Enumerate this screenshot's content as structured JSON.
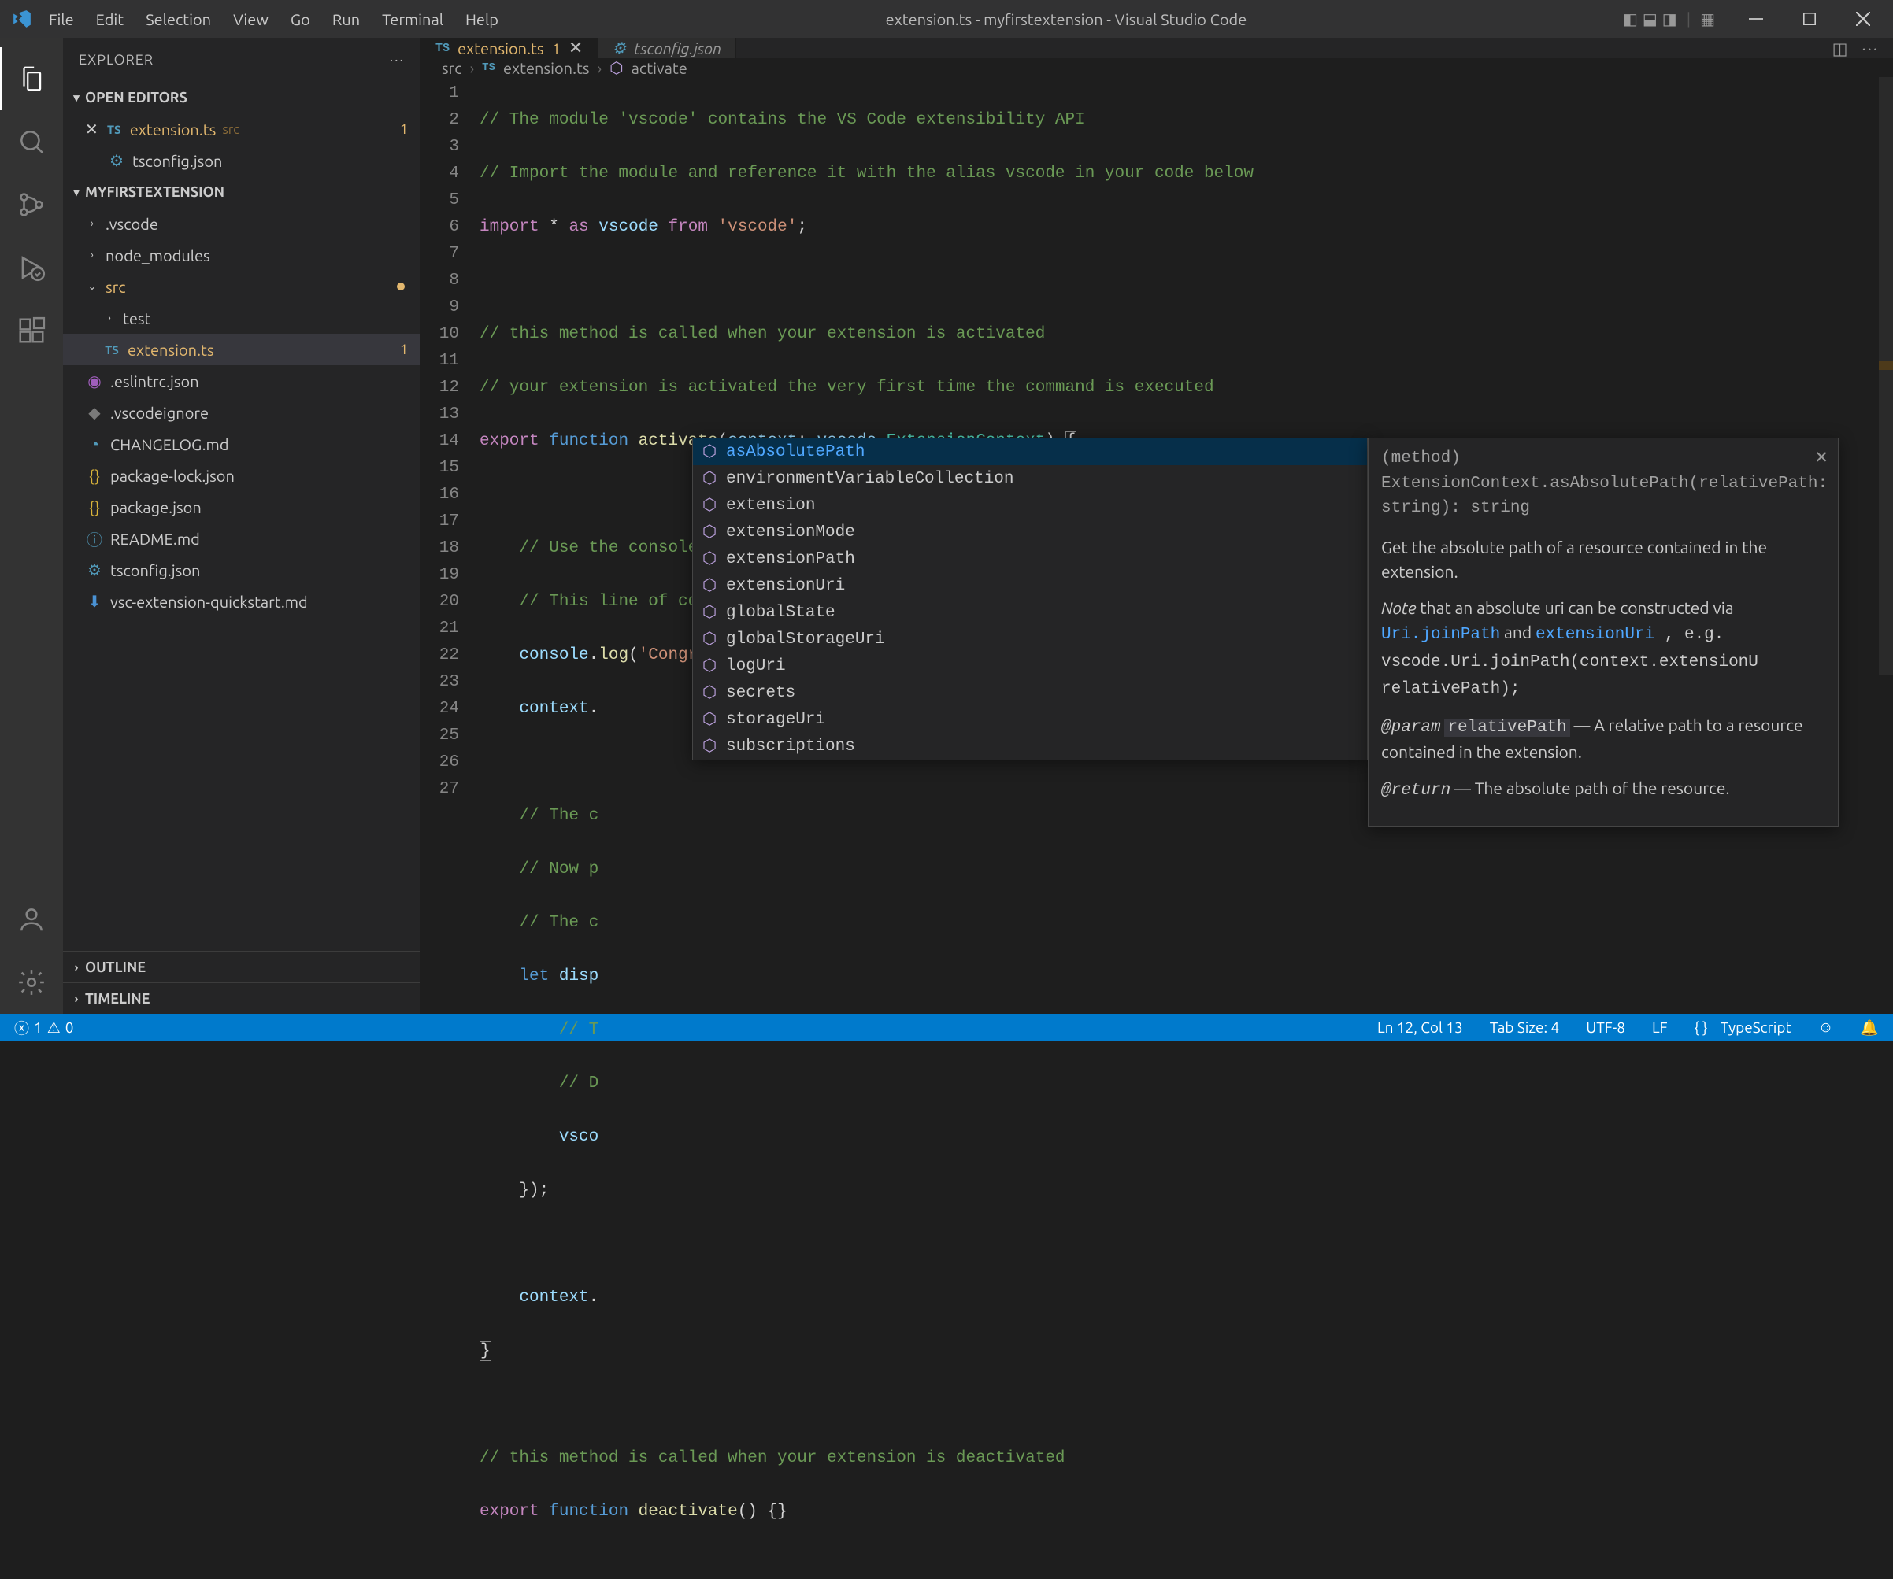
{
  "title": "extension.ts - myfirstextension - Visual Studio Code",
  "menus": [
    "File",
    "Edit",
    "Selection",
    "View",
    "Go",
    "Run",
    "Terminal",
    "Help"
  ],
  "sidebar": {
    "title": "EXPLORER",
    "openEditors": "OPEN EDITORS",
    "project": "MYFIRSTEXTENSION",
    "outline": "OUTLINE",
    "timeline": "TIMELINE",
    "editors": [
      {
        "label": "extension.ts",
        "path": "src",
        "dirty": true,
        "badge": "1",
        "icon": "ts"
      },
      {
        "label": "tsconfig.json",
        "icon": "tsjson"
      }
    ],
    "tree": [
      {
        "label": ".vscode",
        "type": "folder"
      },
      {
        "label": "node_modules",
        "type": "folder"
      },
      {
        "label": "src",
        "type": "folder",
        "open": true,
        "dirty": true
      },
      {
        "label": "test",
        "type": "folder",
        "indent": 1
      },
      {
        "label": "extension.ts",
        "type": "ts",
        "indent": 1,
        "active": true,
        "badge": "1",
        "dirty": true
      },
      {
        "label": ".eslintrc.json",
        "type": "eslint"
      },
      {
        "label": ".vscodeignore",
        "type": "ignore"
      },
      {
        "label": "CHANGELOG.md",
        "type": "md"
      },
      {
        "label": "package-lock.json",
        "type": "json"
      },
      {
        "label": "package.json",
        "type": "json"
      },
      {
        "label": "README.md",
        "type": "readme"
      },
      {
        "label": "tsconfig.json",
        "type": "tsjson"
      },
      {
        "label": "vsc-extension-quickstart.md",
        "type": "dl"
      }
    ]
  },
  "tabs": [
    {
      "label": "extension.ts",
      "dirty": true,
      "badge": "1",
      "active": true,
      "icon": "ts"
    },
    {
      "label": "tsconfig.json",
      "icon": "tsjson"
    }
  ],
  "breadcrumb": {
    "a": "src",
    "b": "extension.ts",
    "c": "activate"
  },
  "code": {
    "lines": 27,
    "l1": "// The module 'vscode' contains the VS Code extensibility API",
    "l2": "// Import the module and reference it with the alias vscode in your code below",
    "l5": "// this method is called when your extension is activated",
    "l6": "// your extension is activated the very first time the command is executed",
    "l9": "// Use the console to output diagnostic information (console.log) and errors (console.error)",
    "l10": "// This line of code will only be executed once when your extension is activated",
    "l11s": "'Congratulations, your extension \"myfirstextension\" is now active!'",
    "l14": "// The c",
    "l15": "// Now p",
    "l16": "// The c",
    "l18": "// T",
    "l19": "// D",
    "l26": "// this method is called when your extension is deactivated",
    "kw_import": "import",
    "kw_as": "as",
    "kw_from": "from",
    "kw_export": "export",
    "kw_function": "function",
    "kw_let": "let",
    "id_vscode": "vscode",
    "str_vscode": "'vscode'",
    "fn_activate": "activate",
    "fn_deactivate": "deactivate",
    "id_context": "context",
    "ty_Ext": "ExtensionContext",
    "id_console": "console",
    "fn_log": "log",
    "id_disp": "disp",
    "id_vsco": "vsco"
  },
  "suggest": [
    "asAbsolutePath",
    "environmentVariableCollection",
    "extension",
    "extensionMode",
    "extensionPath",
    "extensionUri",
    "globalState",
    "globalStorageUri",
    "logUri",
    "secrets",
    "storageUri",
    "subscriptions"
  ],
  "doc": {
    "sig": "(method) ExtensionContext.asAbsolutePath(relativePath: string): string",
    "p1": "Get the absolute path of a resource contained in the extension.",
    "note_prefix": "Note",
    "note_body": " that an absolute uri can be constructed via ",
    "link1": "Uri.joinPath",
    "and": " and ",
    "link2": "extensionUri",
    "note_tail": " , e.g. vscode.Uri.joinPath(context.extensionU relativePath);",
    "param_tag": "@param",
    "param_name": "relativePath",
    "param_body": " — A relative path to a resource contained in the extension.",
    "return_tag": "@return",
    "return_body": " — The absolute path of the resource."
  },
  "status": {
    "errors": "1",
    "warnings": "0",
    "ln": "Ln 12, Col 13",
    "tab": "Tab Size: 4",
    "enc": "UTF-8",
    "eol": "LF",
    "lang": "TypeScript"
  }
}
